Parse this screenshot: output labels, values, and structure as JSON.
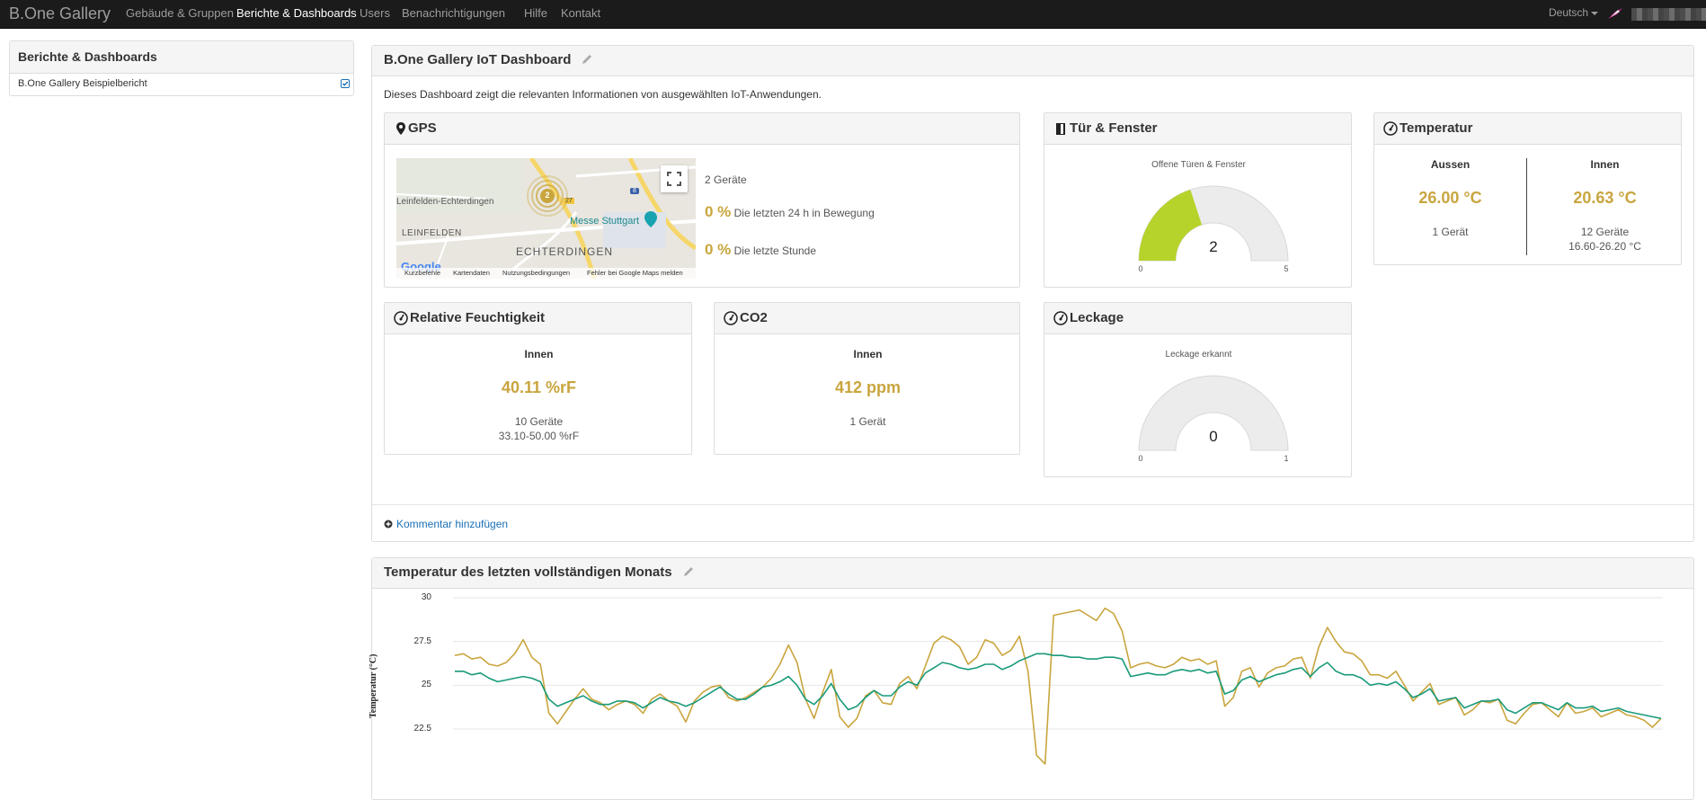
{
  "nav": {
    "brand": "B.One Gallery",
    "items": [
      {
        "label": "Gebäude & Gruppen"
      },
      {
        "label": "Berichte & Dashboards"
      },
      {
        "label": "Users"
      },
      {
        "label": "Benachrichtigungen"
      },
      {
        "label": "Hilfe"
      },
      {
        "label": "Kontakt"
      }
    ],
    "language": "Deutsch"
  },
  "sidebar": {
    "title": "Berichte & Dashboards",
    "items": [
      {
        "label": "B.One Gallery Beispielbericht"
      }
    ]
  },
  "dashboard": {
    "title": "B.One Gallery IoT Dashboard",
    "description": "Dieses Dashboard zeigt die relevanten Informationen von ausgewählten IoT-Anwendungen.",
    "add_comment": "Kommentar hinzufügen"
  },
  "gps": {
    "title": "GPS",
    "devices": "2 Geräte",
    "moving_24h_value": "0 %",
    "moving_24h_label": "Die letzten 24 h in Bewegung",
    "last_hour_value": "0 %",
    "last_hour_label": "Die letzte Stunde",
    "map": {
      "cluster_count": "2",
      "labels": [
        "Leinfelden-Echterdingen",
        "LEINFELDEN",
        "ECHTERDINGEN",
        "Messe Stuttgart"
      ],
      "road_numbers": [
        "27",
        "8"
      ],
      "google": "Google",
      "footer": [
        "Kurzbefehle",
        "Kartendaten",
        "Nutzungsbedingungen",
        "Fehler bei Google Maps melden"
      ]
    }
  },
  "door": {
    "title": "Tür & Fenster",
    "subtitle": "Offene Türen & Fenster",
    "value": 2,
    "value_label": "2",
    "min_label": "0",
    "max_label": "5",
    "fraction": 0.4,
    "color": "#b5d32a"
  },
  "temperature": {
    "title": "Temperatur",
    "outside": {
      "label": "Aussen",
      "value": "26.00 °C",
      "devices": "1 Gerät"
    },
    "inside": {
      "label": "Innen",
      "value": "20.63 °C",
      "devices": "12 Geräte",
      "range": "16.60-26.20 °C"
    }
  },
  "humidity": {
    "title": "Relative Feuchtigkeit",
    "label": "Innen",
    "value": "40.11 %rF",
    "devices": "10 Geräte",
    "range": "33.10-50.00 %rF"
  },
  "co2": {
    "title": "CO2",
    "label": "Innen",
    "value": "412 ppm",
    "devices": "1 Gerät"
  },
  "leak": {
    "title": "Leckage",
    "subtitle": "Leckage erkannt",
    "value_label": "0",
    "min_label": "0",
    "max_label": "1",
    "fraction": 0
  },
  "chart_panel": {
    "title": "Temperatur des letzten vollständigen Monats"
  },
  "chart_data": {
    "type": "line",
    "title": "Temperatur des letzten vollständigen Monats",
    "ylabel": "Temperatur (°C)",
    "yticks": [
      "30",
      "27.5",
      "25",
      "22.5"
    ],
    "ylim": [
      20.5,
      30
    ],
    "grid": true,
    "series": [
      {
        "color": "#c9a53e",
        "values": [
          26.7,
          26.8,
          26.5,
          26.6,
          26.2,
          26.1,
          26.3,
          26.8,
          27.6,
          26.6,
          26.2,
          23.4,
          22.8,
          23.5,
          24.2,
          24.8,
          24.2,
          24.0,
          23.6,
          23.9,
          24.1,
          23.9,
          23.4,
          24.2,
          24.5,
          24.1,
          23.8,
          22.9,
          24.1,
          24.6,
          24.9,
          25.0,
          24.3,
          24.1,
          24.3,
          24.6,
          24.9,
          25.4,
          26.2,
          27.3,
          26.3,
          24.2,
          23.1,
          24.6,
          25.9,
          23.2,
          22.6,
          23.1,
          24.4,
          24.7,
          24.0,
          23.9,
          25.1,
          25.5,
          24.8,
          26.1,
          27.4,
          27.8,
          27.6,
          27.2,
          26.2,
          26.6,
          27.6,
          27.4,
          26.7,
          27.0,
          27.8,
          25.8,
          21.0,
          20.5,
          29.0,
          29.1,
          29.2,
          29.3,
          29.0,
          28.7,
          29.4,
          29.1,
          28.1,
          26.0,
          26.2,
          26.3,
          26.1,
          26.0,
          26.2,
          26.6,
          26.4,
          26.5,
          26.2,
          26.4,
          23.8,
          24.3,
          25.8,
          26.0,
          24.9,
          25.7,
          26.0,
          26.1,
          26.5,
          26.6,
          25.4,
          27.2,
          28.3,
          27.5,
          26.9,
          26.8,
          26.4,
          25.6,
          25.6,
          25.4,
          25.8,
          25.0,
          24.1,
          24.6,
          25.1,
          23.9,
          24.1,
          24.3,
          23.3,
          23.6,
          24.1,
          24.0,
          24.2,
          23.0,
          22.8,
          23.4,
          23.9,
          24.0,
          23.6,
          23.2,
          24.0,
          23.4,
          23.5,
          23.7,
          23.2,
          23.4,
          23.6,
          23.3,
          23.2,
          23.0,
          22.6,
          23.1
        ]
      },
      {
        "color": "#1a9a7a",
        "values": [
          25.8,
          25.8,
          25.6,
          25.7,
          25.4,
          25.2,
          25.3,
          25.4,
          25.5,
          25.4,
          25.2,
          24.2,
          23.8,
          24.0,
          24.2,
          24.4,
          24.1,
          23.9,
          23.9,
          24.1,
          24.1,
          24.0,
          23.7,
          24.0,
          24.3,
          24.1,
          24.0,
          23.8,
          24.0,
          24.3,
          24.6,
          24.9,
          24.5,
          24.2,
          24.2,
          24.5,
          24.9,
          25.0,
          25.2,
          25.5,
          25.0,
          24.2,
          23.9,
          24.4,
          25.1,
          24.2,
          23.6,
          23.8,
          24.3,
          24.7,
          24.4,
          24.4,
          24.9,
          25.2,
          25.0,
          25.7,
          26.0,
          26.3,
          26.2,
          26.0,
          25.9,
          26.0,
          26.2,
          26.2,
          25.9,
          26.1,
          26.4,
          26.6,
          26.8,
          26.8,
          26.7,
          26.7,
          26.6,
          26.6,
          26.5,
          26.5,
          26.6,
          26.6,
          26.5,
          25.5,
          25.6,
          25.7,
          25.6,
          25.6,
          25.8,
          25.9,
          25.8,
          25.9,
          25.7,
          25.8,
          24.5,
          24.7,
          25.3,
          25.5,
          25.2,
          25.4,
          25.6,
          25.7,
          25.9,
          26.0,
          25.5,
          26.0,
          26.3,
          25.8,
          25.6,
          25.6,
          25.4,
          25.0,
          25.1,
          25.0,
          25.2,
          24.8,
          24.3,
          24.5,
          24.8,
          24.1,
          24.2,
          24.3,
          23.7,
          23.9,
          24.1,
          24.1,
          24.2,
          23.6,
          23.4,
          23.7,
          24.0,
          24.0,
          23.8,
          23.6,
          24.0,
          23.7,
          23.7,
          23.8,
          23.5,
          23.6,
          23.7,
          23.5,
          23.4,
          23.3,
          23.2,
          23.1
        ]
      }
    ]
  },
  "colors": {
    "accent_gold": "#c9a53e",
    "navbar": "#1b1b1b",
    "link": "#1a6fb5"
  }
}
